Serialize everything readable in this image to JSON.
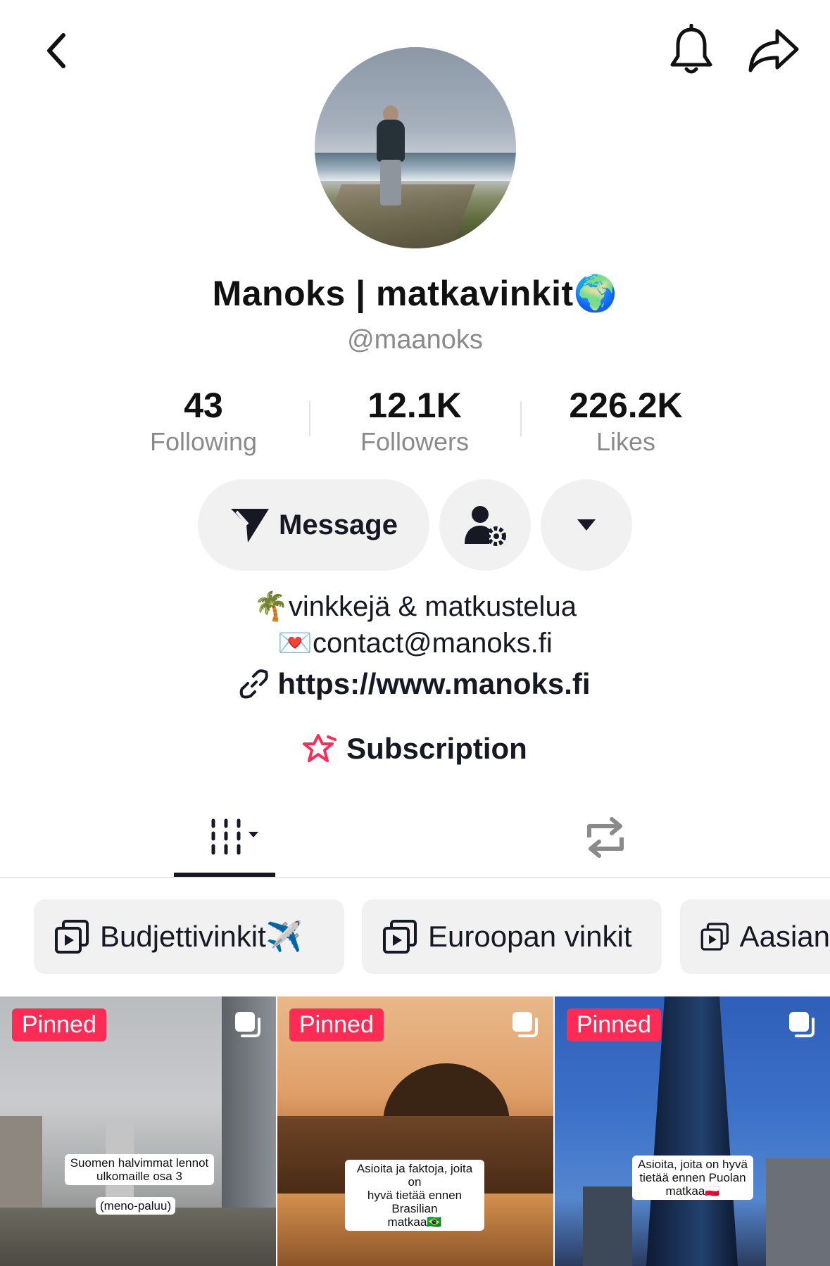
{
  "header": {
    "back_icon": "chevron-left-icon",
    "bell_icon": "bell-icon",
    "share_icon": "share-arrow-icon"
  },
  "profile": {
    "display_name": "Manoks | matkavinkit🌍",
    "handle": "@maanoks"
  },
  "stats": [
    {
      "value": "43",
      "label": "Following"
    },
    {
      "value": "12.1K",
      "label": "Followers"
    },
    {
      "value": "226.2K",
      "label": "Likes"
    }
  ],
  "actions": {
    "message_label": "Message",
    "message_icon": "send-icon",
    "friend_settings_icon": "user-gear-icon",
    "more_icon": "caret-down-icon"
  },
  "bio": {
    "line1": "🌴vinkkejä & matkustelua",
    "line2": "💌contact@manoks.fi",
    "link": "https://www.manoks.fi",
    "subscription_label": "Subscription"
  },
  "tabs": {
    "videos_icon": "grid-icon",
    "reposts_icon": "repost-icon"
  },
  "playlists": [
    {
      "label": "Budjettivinkit✈️"
    },
    {
      "label": "Euroopan vinkit"
    },
    {
      "label": "Aasian"
    }
  ],
  "videos": [
    {
      "badge": "Pinned",
      "caption_line1": "Suomen halvimmat lennot",
      "caption_line2": "ulkomaille osa 3",
      "caption_line3": "(meno-paluu)"
    },
    {
      "badge": "Pinned",
      "caption_line1": "Asioita ja faktoja, joita on",
      "caption_line2": "hyvä tietää ennen Brasilian",
      "caption_line3": "matkaa🇧🇷"
    },
    {
      "badge": "Pinned",
      "caption_line1": "Asioita, joita on hyvä",
      "caption_line2": "tietää ennen Puolan",
      "caption_line3": "matkaa🇵🇱"
    }
  ],
  "colors": {
    "accent": "#fe2c55",
    "text": "#161823",
    "secondary_text": "#8a8a8a",
    "pill_bg": "#f1f1f2"
  }
}
